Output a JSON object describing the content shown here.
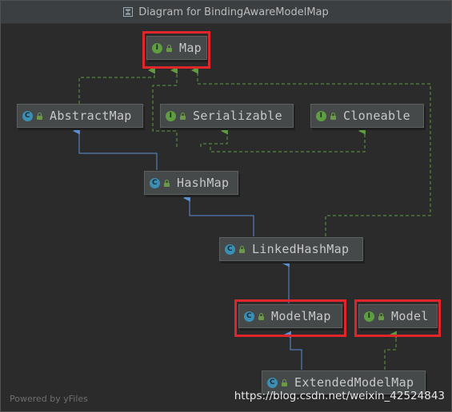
{
  "window": {
    "title": "Diagram for BindingAwareModelMap",
    "icon": "diagram-icon"
  },
  "nodes": {
    "map": {
      "label": "Map",
      "kind": "interface",
      "kind_letter": "I"
    },
    "abstract_map": {
      "label": "AbstractMap",
      "kind": "class",
      "kind_letter": "C"
    },
    "serializable": {
      "label": "Serializable",
      "kind": "interface",
      "kind_letter": "I"
    },
    "cloneable": {
      "label": "Cloneable",
      "kind": "interface",
      "kind_letter": "I"
    },
    "hash_map": {
      "label": "HashMap",
      "kind": "class",
      "kind_letter": "C"
    },
    "linked_hash_map": {
      "label": "LinkedHashMap",
      "kind": "class",
      "kind_letter": "C"
    },
    "model_map": {
      "label": "ModelMap",
      "kind": "class",
      "kind_letter": "C"
    },
    "model": {
      "label": "Model",
      "kind": "interface",
      "kind_letter": "I"
    },
    "extended_model_map": {
      "label": "ExtendedModelMap",
      "kind": "class",
      "kind_letter": "C"
    }
  },
  "edges": [
    {
      "from": "abstract_map",
      "to": "map",
      "type": "implements"
    },
    {
      "from": "hash_map",
      "to": "map",
      "type": "implements"
    },
    {
      "from": "linked_hash_map",
      "to": "map",
      "type": "implements"
    },
    {
      "from": "hash_map",
      "to": "abstract_map",
      "type": "extends"
    },
    {
      "from": "hash_map",
      "to": "serializable",
      "type": "implements"
    },
    {
      "from": "hash_map",
      "to": "cloneable",
      "type": "implements"
    },
    {
      "from": "linked_hash_map",
      "to": "hash_map",
      "type": "extends"
    },
    {
      "from": "model_map",
      "to": "linked_hash_map",
      "type": "extends"
    },
    {
      "from": "extended_model_map",
      "to": "model_map",
      "type": "extends"
    },
    {
      "from": "extended_model_map",
      "to": "model",
      "type": "implements"
    }
  ],
  "highlighted": [
    "map",
    "model_map",
    "model"
  ],
  "colors": {
    "background": "#2b2b2b",
    "node_fill": "#45494a",
    "extends_edge": "#5a8fd6",
    "implements_edge": "#5f9e40",
    "highlight": "#e0252b",
    "interface_badge": "#5f9e40",
    "class_badge": "#3c8fb4"
  },
  "footer": {
    "powered_by": "Powered by yFiles",
    "watermark": "https://blog.csdn.net/weixin_42524843"
  }
}
